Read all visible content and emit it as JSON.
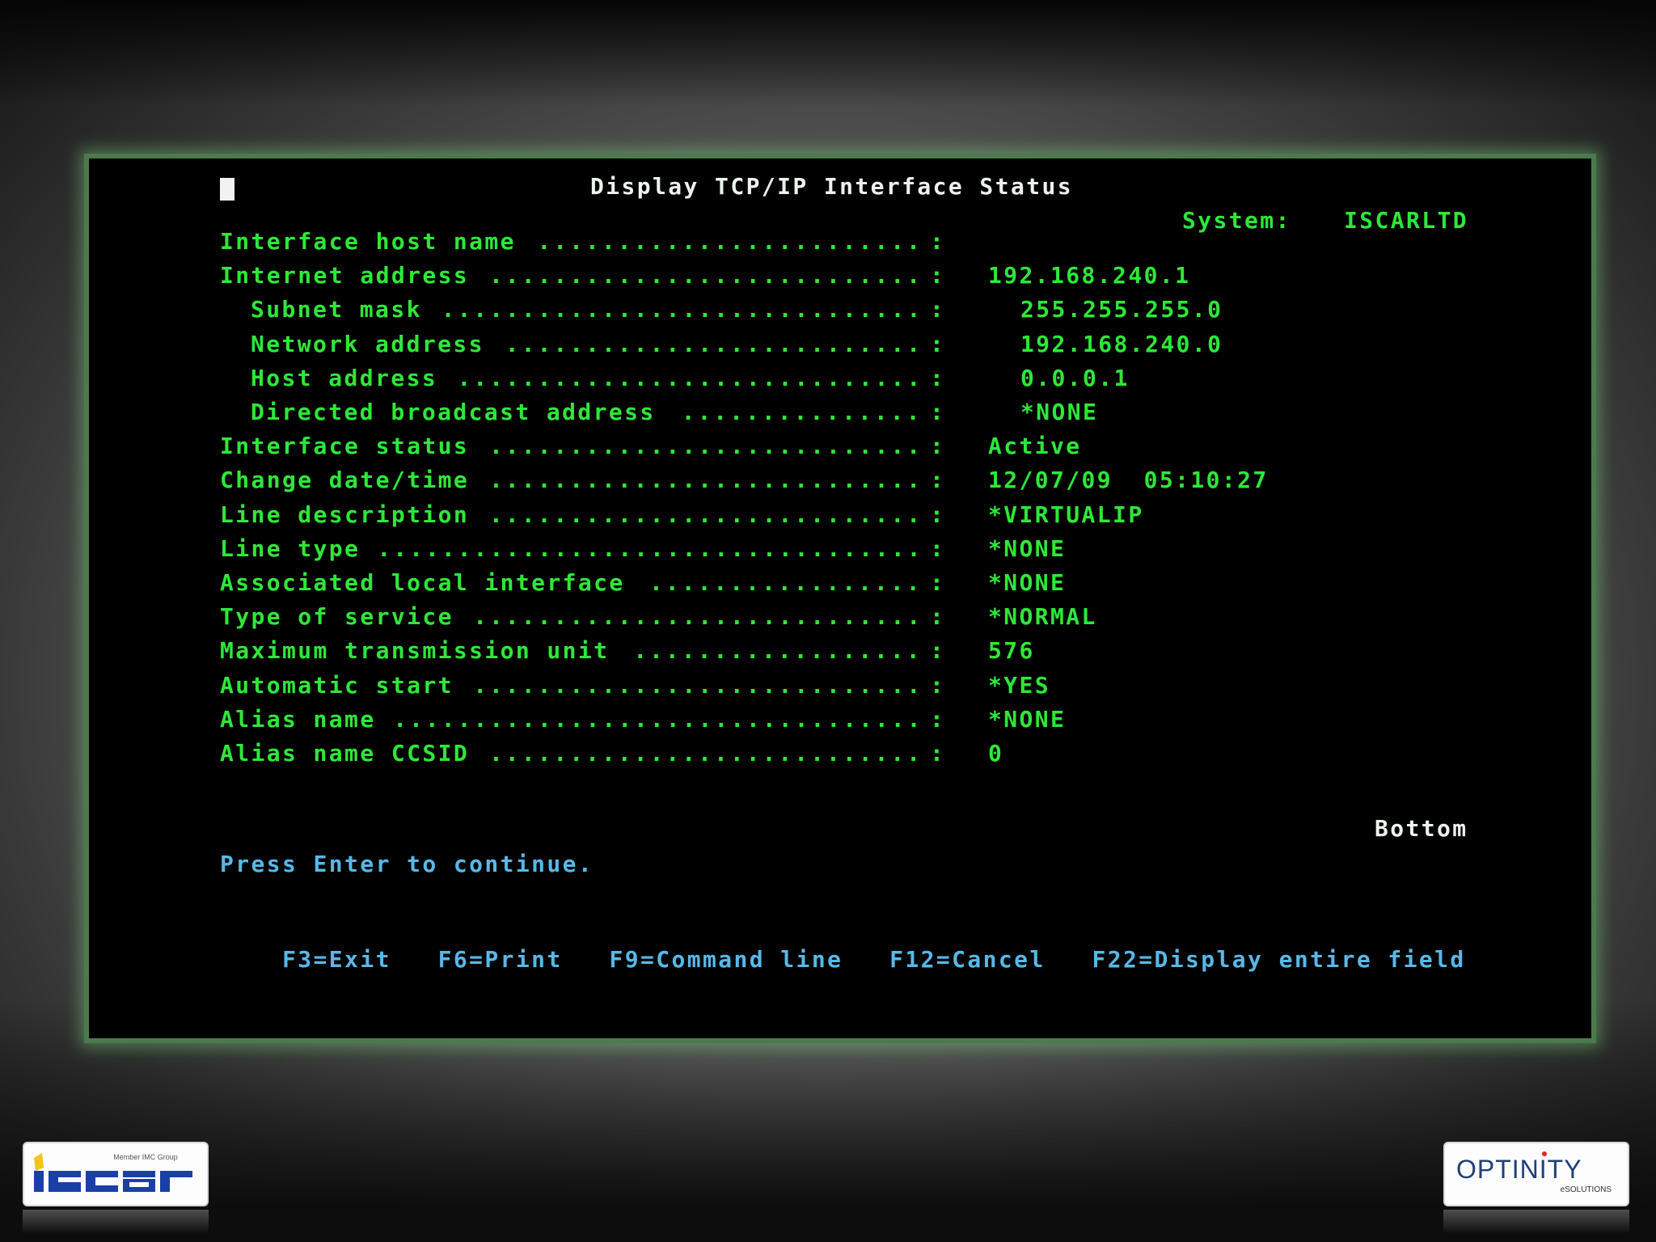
{
  "screen": {
    "title": "Display TCP/IP Interface Status",
    "system_label": "System:",
    "system_value": "ISCARLTD",
    "rows": [
      {
        "label": "Interface host name",
        "indent": false,
        "value": ""
      },
      {
        "label": "Internet address",
        "indent": false,
        "value": "192.168.240.1"
      },
      {
        "label": "Subnet mask",
        "indent": true,
        "value": "255.255.255.0"
      },
      {
        "label": "Network address",
        "indent": true,
        "value": "192.168.240.0"
      },
      {
        "label": "Host address",
        "indent": true,
        "value": "0.0.0.1"
      },
      {
        "label": "Directed broadcast address",
        "indent": true,
        "value": "*NONE"
      },
      {
        "label": "Interface status",
        "indent": false,
        "value": "Active"
      },
      {
        "label": "Change date/time",
        "indent": false,
        "value": "12/07/09  05:10:27"
      },
      {
        "label": "Line description",
        "indent": false,
        "value": "*VIRTUALIP"
      },
      {
        "label": "Line type",
        "indent": false,
        "value": "*NONE"
      },
      {
        "label": "Associated local interface",
        "indent": false,
        "value": "*NONE"
      },
      {
        "label": "Type of service",
        "indent": false,
        "value": "*NORMAL"
      },
      {
        "label": "Maximum transmission unit",
        "indent": false,
        "value": "576"
      },
      {
        "label": "Automatic start",
        "indent": false,
        "value": "*YES"
      },
      {
        "label": "Alias name",
        "indent": false,
        "value": "*NONE"
      },
      {
        "label": "Alias name CCSID",
        "indent": false,
        "value": "0"
      }
    ],
    "colon": ":",
    "bottom_indicator": "Bottom",
    "prompt": "Press Enter to continue.",
    "function_keys": [
      "F3=Exit",
      "F6=Print",
      "F9=Command line",
      "F12=Cancel",
      "F22=Display entire field"
    ]
  },
  "logos": {
    "left": {
      "text": "iscar",
      "tagline": "Member IMC Group"
    },
    "right": {
      "text": "OPTINITY",
      "tagline": "eSOLUTIONS"
    }
  },
  "colors": {
    "terminal_green": "#2ee838",
    "terminal_white": "#ecf3ec",
    "terminal_blue": "#58b8e8",
    "bezel_glow": "#4c7a4c"
  }
}
